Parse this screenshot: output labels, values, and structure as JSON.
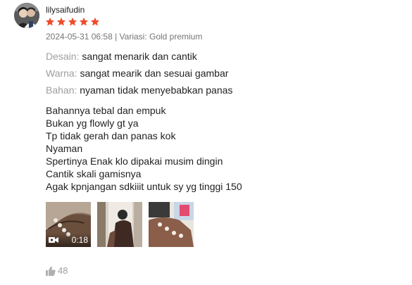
{
  "review": {
    "username": "lilysaifudin",
    "rating": 5,
    "rating_max": 5,
    "star_color": "#ee4d2d",
    "meta_text": "2024-05-31 06:58 | Variasi: Gold premium",
    "attributes": [
      {
        "key": "Desain:",
        "value": "sangat menarik dan cantik"
      },
      {
        "key": "Warna:",
        "value": "sangat mearik dan sesuai gambar"
      },
      {
        "key": "Bahan:",
        "value": "nyaman tidak menyebabkan panas"
      }
    ],
    "body_lines": [
      "Bahannya tebal dan empuk",
      "Bukan yg flowly gt ya",
      "Tp tidak gerah dan panas kok",
      "Nyaman",
      "Spertinya Enak klo dipakai musim dingin",
      "Cantik skali gamisnya",
      "Agak kpnjangan sdkiiit untuk sy yg tinggi 150"
    ],
    "media": {
      "video_duration": "0:18",
      "video_icon": "video-camera-icon",
      "thumbnail_count": 3
    },
    "like": {
      "icon": "thumbs-up-icon",
      "count": "48"
    }
  }
}
